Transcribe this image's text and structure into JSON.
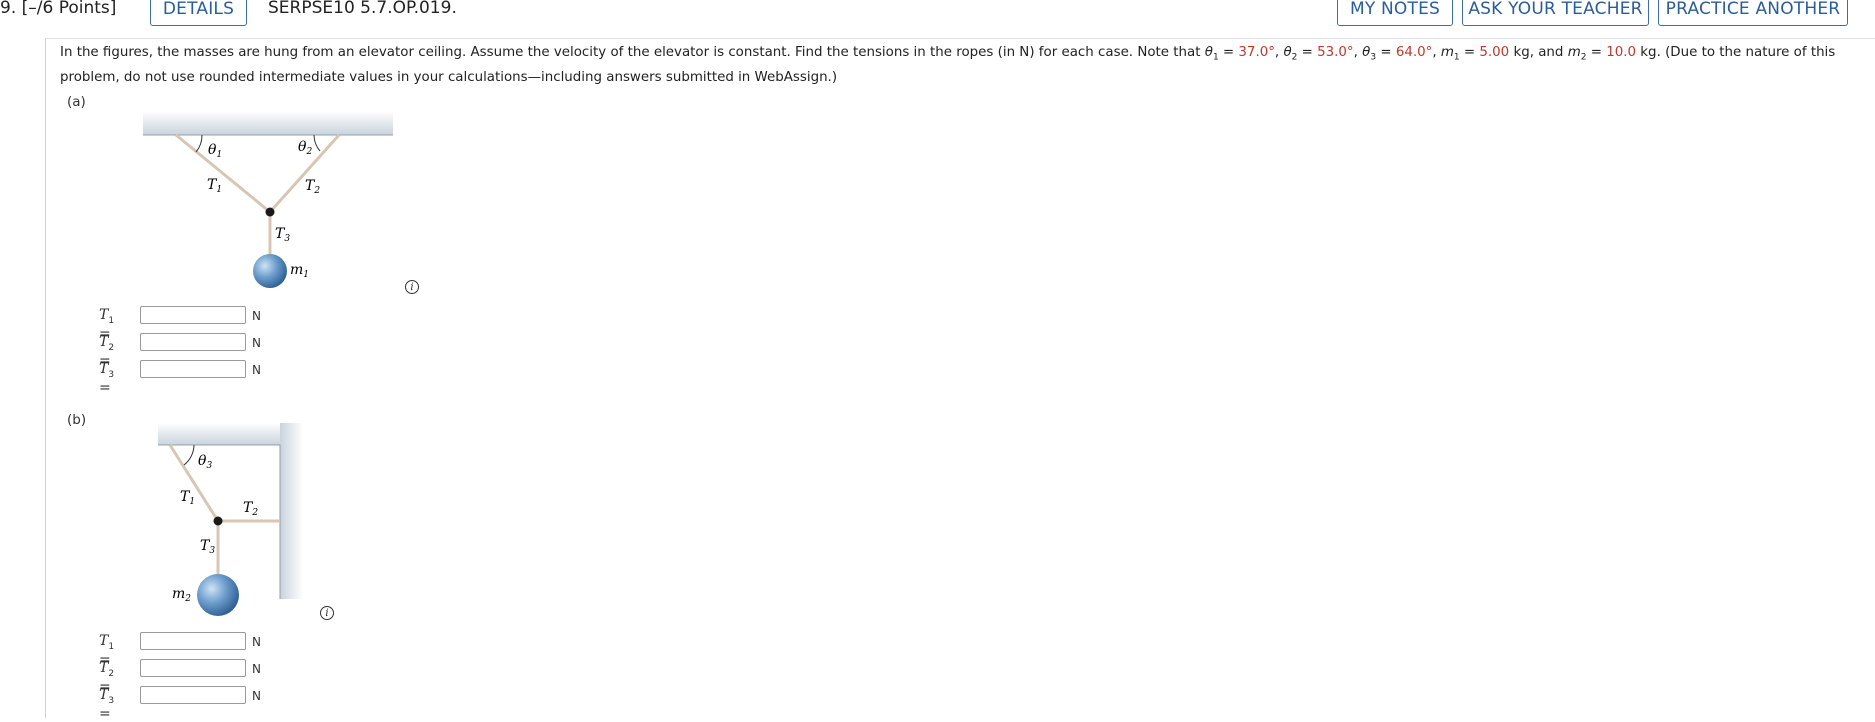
{
  "header": {
    "question_number": "9. [–/6 Points]",
    "details_label": "DETAILS",
    "problem_code": "SERPSE10 5.7.OP.019.",
    "my_notes_label": "MY NOTES",
    "ask_teacher_label": "ASK YOUR TEACHER",
    "practice_another_label": "PRACTICE ANOTHER"
  },
  "prompt": {
    "text_1": "In the figures, the masses are hung from an elevator ceiling. Assume the velocity of the elevator is constant. Find the tensions in the ropes (in N) for each case. Note that ",
    "theta1_label": "θ",
    "theta1_sub": "1",
    "theta1_value": "37.0°",
    "theta2_label": "θ",
    "theta2_sub": "2",
    "theta2_value": "53.0°",
    "theta3_label": "θ",
    "theta3_sub": "3",
    "theta3_value": "64.0°",
    "m1_label": "m",
    "m1_sub": "1",
    "m1_value": "5.00",
    "m2_label": "m",
    "m2_sub": "2",
    "m2_value": "10.0",
    "unit_kg": "kg",
    "text_2": "(Due to the nature of this problem, do not use rounded intermediate values in your calculations—including answers submitted in WebAssign.)"
  },
  "figure_a": {
    "part_label": "(a)",
    "theta1": "θ",
    "theta1_sub": "1",
    "theta2": "θ",
    "theta2_sub": "2",
    "t1": "T",
    "t1_sub": "1",
    "t2": "T",
    "t2_sub": "2",
    "t3": "T",
    "t3_sub": "3",
    "m1": "m",
    "m1_sub": "1"
  },
  "figure_b": {
    "part_label": "(b)",
    "theta3": "θ",
    "theta3_sub": "3",
    "t1": "T",
    "t1_sub": "1",
    "t2": "T",
    "t2_sub": "2",
    "t3": "T",
    "t3_sub": "3",
    "m2": "m",
    "m2_sub": "2"
  },
  "answers_a": [
    {
      "var": "T",
      "sub": "1",
      "eq": "=",
      "value": "",
      "unit": "N"
    },
    {
      "var": "T",
      "sub": "2",
      "eq": "=",
      "value": "",
      "unit": "N"
    },
    {
      "var": "T",
      "sub": "3",
      "eq": "=",
      "value": "",
      "unit": "N"
    }
  ],
  "answers_b": [
    {
      "var": "T",
      "sub": "1",
      "eq": "=",
      "value": "",
      "unit": "N"
    },
    {
      "var": "T",
      "sub": "2",
      "eq": "=",
      "value": "",
      "unit": "N"
    },
    {
      "var": "T",
      "sub": "3",
      "eq": "=",
      "value": "",
      "unit": "N"
    }
  ],
  "info_icon_glyph": "i"
}
